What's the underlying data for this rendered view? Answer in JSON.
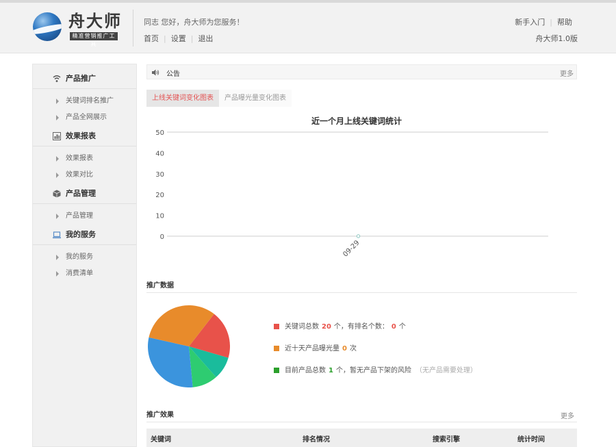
{
  "header": {
    "logo_title": "舟大师",
    "logo_subtitle": "精准营销推广工具",
    "welcome": "同志 您好，舟大师为您服务！",
    "nav": [
      "首页",
      "设置",
      "退出"
    ],
    "right_links": [
      "新手入门",
      "帮助"
    ],
    "version": "舟大师1.0版"
  },
  "sidebar": {
    "sections": [
      {
        "label": "产品推广",
        "icon": "wifi-icon",
        "items": [
          "关键词排名推广",
          "产品全网展示"
        ]
      },
      {
        "label": "效果报表",
        "icon": "chart-icon",
        "items": [
          "效果报表",
          "效果对比"
        ]
      },
      {
        "label": "产品管理",
        "icon": "cube-icon",
        "items": [
          "产品管理"
        ]
      },
      {
        "label": "我的服务",
        "icon": "laptop-icon",
        "items": [
          "我的服务",
          "消费清单"
        ]
      }
    ]
  },
  "notice": {
    "label": "公告",
    "more": "更多"
  },
  "chart_tabs": [
    "上线关键词变化图表",
    "产品曝光量变化图表"
  ],
  "chart_data": {
    "type": "line",
    "title": "近一个月上线关键词统计",
    "x": [
      "09-29"
    ],
    "series": [
      {
        "values": [
          0
        ]
      }
    ],
    "yticks": [
      "50",
      "40",
      "30",
      "20",
      "10",
      "0"
    ],
    "ylim": [
      0,
      50
    ],
    "grid": false,
    "color": "#8cc7c0"
  },
  "promo": {
    "title": "推广数据",
    "pie": {
      "type": "pie",
      "slices": [
        {
          "value": 19,
          "color": "#e8524a"
        },
        {
          "value": 9,
          "color": "#1abc9c"
        },
        {
          "value": 10,
          "color": "#2ecc71"
        },
        {
          "value": 30,
          "color": "#3b94dd"
        },
        {
          "value": 32,
          "color": "#e88b2b"
        }
      ]
    },
    "legend": [
      {
        "color": "#e8524a",
        "before": "关键词总数",
        "num1": "20",
        "mid": "个，有排名个数：",
        "num2": "0",
        "after": "个"
      },
      {
        "color": "#e88b2b",
        "before": "近十天产品曝光量",
        "num1": "0",
        "after": "次"
      },
      {
        "color": "#2ca02c",
        "before": "目前产品总数",
        "num1": "1",
        "mid": "个，暂无产品下架的风险",
        "note": "（无产品需要处理）"
      }
    ]
  },
  "effect": {
    "title": "推广效果",
    "more": "更多",
    "columns": [
      "关键词",
      "排名情况",
      "搜索引擎",
      "统计时间"
    ]
  }
}
